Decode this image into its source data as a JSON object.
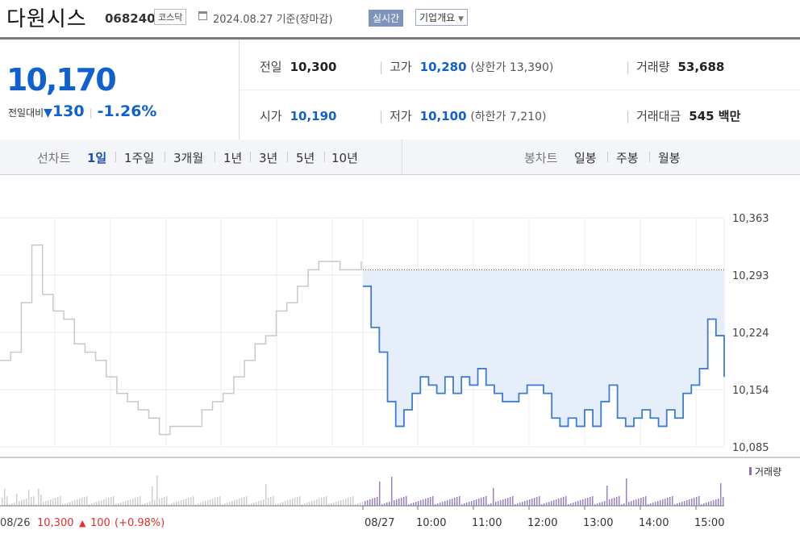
{
  "header": {
    "name": "다원시스",
    "code": "068240",
    "market": "코스닥",
    "date": "2024.08.27 기준(장마감)",
    "realtime": "실시간",
    "company_info": "기업개요"
  },
  "quote": {
    "price": "10,170",
    "change_label": "전일대비",
    "change": "130",
    "change_pct": "-1.26%",
    "stats": [
      {
        "label": "전일",
        "value": "10,300"
      },
      {
        "label": "고가",
        "value": "10,280",
        "sub": "(상한가 13,390)"
      },
      {
        "label": "거래량",
        "value": "53,688"
      },
      {
        "label": "시가",
        "value": "10,190"
      },
      {
        "label": "저가",
        "value": "10,100",
        "sub": "(하한가 7,210)"
      },
      {
        "label": "거래대금",
        "value": "545 백만"
      }
    ]
  },
  "tabs": {
    "line_label": "선차트",
    "line_items": [
      "1일",
      "1주일",
      "3개월",
      "1년",
      "3년",
      "5년",
      "10년"
    ],
    "selected": "1일",
    "candle_label": "봉차트",
    "candle_items": [
      "일봉",
      "주봉",
      "월봉"
    ]
  },
  "chart_data": {
    "type": "line",
    "y_ticks": [
      "10,363",
      "10,293",
      "10,224",
      "10,154",
      "10,085"
    ],
    "x_ticks": [
      "08/27",
      "10:00",
      "11:00",
      "12:00",
      "13:00",
      "14:00",
      "15:00"
    ],
    "prev_close": 10300,
    "volume_label": "거래량",
    "prev_day": {
      "date": "08/26",
      "close": "10,300",
      "change": "100",
      "change_pct": "(+0.98%)"
    },
    "series": [
      {
        "values": [
          10190,
          10200,
          10260,
          10330,
          10270,
          10250,
          10240,
          10210,
          10200,
          10190,
          10170,
          10150,
          10140,
          10130,
          10120,
          10100,
          10110,
          10110,
          10110,
          10130,
          10140,
          10150,
          10170,
          10190,
          10210,
          10220,
          10250,
          10260,
          10280,
          10300,
          10310,
          10310,
          10300,
          10300,
          10310
        ]
      },
      {
        "values": [
          10280,
          10230,
          10200,
          10140,
          10110,
          10130,
          10150,
          10170,
          10160,
          10150,
          10170,
          10150,
          10170,
          10160,
          10180,
          10160,
          10150,
          10140,
          10140,
          10150,
          10160,
          10160,
          10150,
          10120,
          10110,
          10120,
          10110,
          10130,
          10110,
          10140,
          10160,
          10120,
          10110,
          10120,
          10130,
          10120,
          10110,
          10130,
          10120,
          10150,
          10160,
          10180,
          10240,
          10220,
          10170
        ]
      }
    ]
  }
}
